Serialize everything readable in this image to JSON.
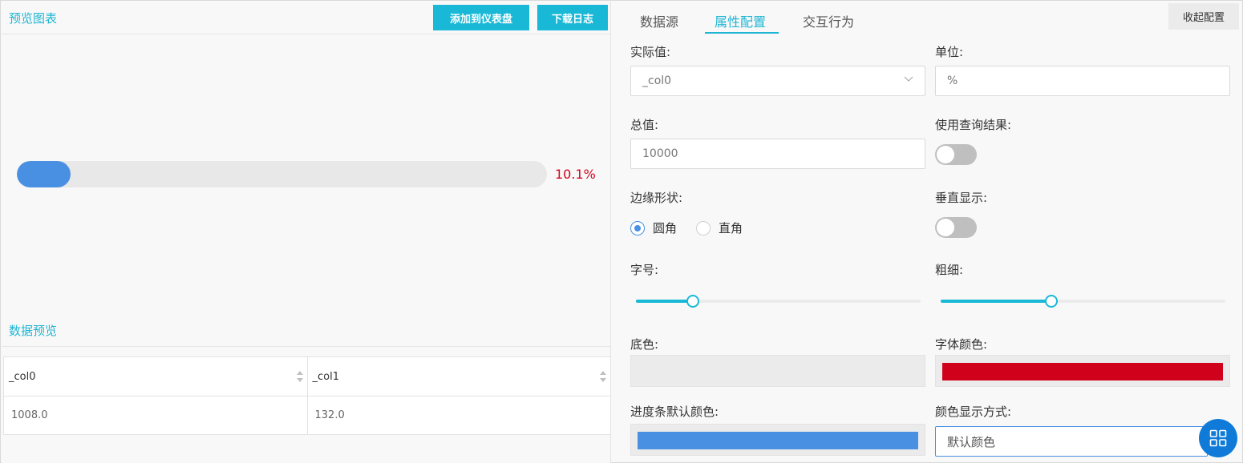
{
  "preview": {
    "title": "预览图表",
    "add_to_dashboard": "添加到仪表盘",
    "download_log": "下载日志",
    "progress_value": 0.101,
    "progress_label": "10.1%",
    "progress_color": "#4a90e2",
    "progress_text_color": "#d0021b"
  },
  "data_preview": {
    "title": "数据预览",
    "columns": [
      "_col0",
      "_col1"
    ],
    "rows": [
      [
        "1008.0",
        "132.0"
      ]
    ]
  },
  "config": {
    "tabs": [
      "数据源",
      "属性配置",
      "交互行为"
    ],
    "active_tab": "属性配置",
    "collapse_label": "收起配置",
    "actual_value_label": "实际值:",
    "actual_value": "_col0",
    "unit_label": "单位:",
    "unit_value": "%",
    "total_label": "总值:",
    "total_value": "10000",
    "use_query_label": "使用查询结果:",
    "use_query_on": false,
    "edge_shape_label": "边缘形状:",
    "edge_options": [
      "圆角",
      "直角"
    ],
    "edge_selected": "圆角",
    "vertical_label": "垂直显示:",
    "vertical_on": false,
    "font_size_label": "字号:",
    "font_size_level": 0.2,
    "thickness_label": "粗细:",
    "thickness_level": 0.39,
    "bg_color_label": "底色:",
    "bg_color": "#ebebeb",
    "font_color_label": "字体颜色:",
    "font_color": "#d0021b",
    "bar_color_label": "进度条默认颜色:",
    "bar_color": "#4a90e2",
    "color_mode_label": "颜色显示方式:",
    "color_mode_value": "默认颜色"
  },
  "icons": {
    "select": "chevron-down-icon",
    "sort": "sort-icon",
    "fab": "grid-icon"
  }
}
